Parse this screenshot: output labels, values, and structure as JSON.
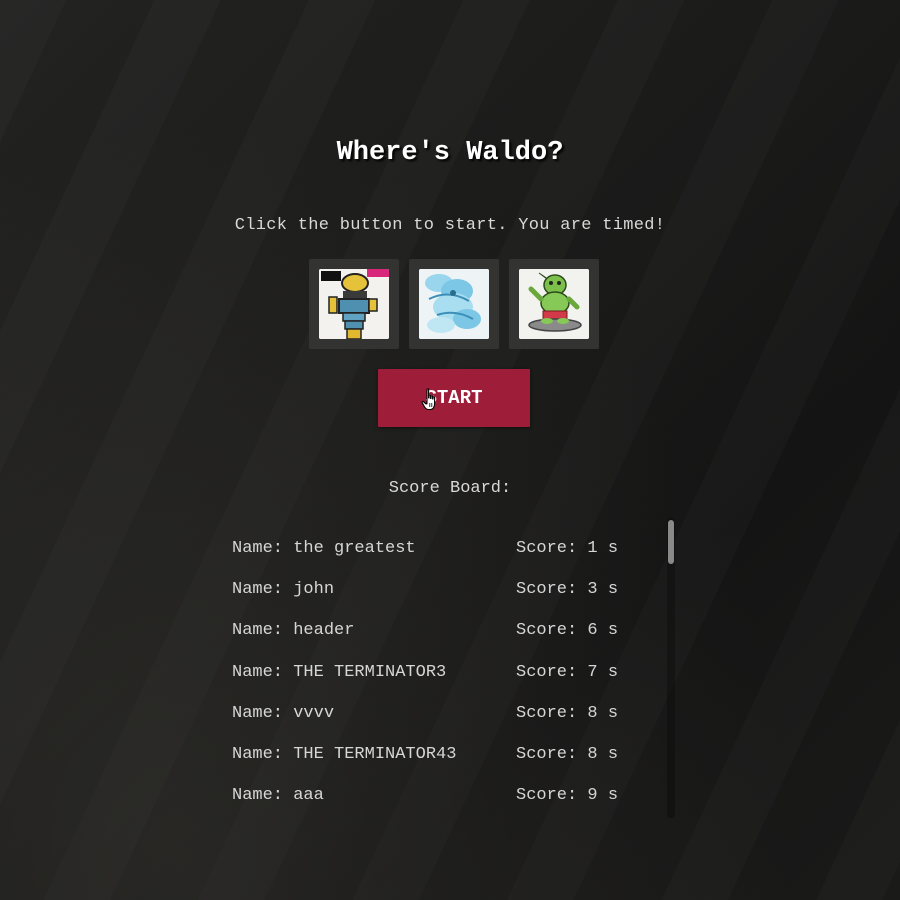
{
  "page": {
    "title": "Where's Waldo?",
    "instructions": "Click the button to start. You are timed!",
    "start_button_label": "START",
    "scoreboard_title": "Score Board:"
  },
  "characters": [
    {
      "icon": "robot-character-icon"
    },
    {
      "icon": "ghost-character-icon"
    },
    {
      "icon": "goblin-character-icon"
    }
  ],
  "scoreboard": {
    "rows": [
      {
        "name": "Name: the greatest",
        "score": "Score: 1 s"
      },
      {
        "name": "Name: john",
        "score": "Score: 3 s"
      },
      {
        "name": "Name: header",
        "score": "Score: 6 s"
      },
      {
        "name": "Name: THE TERMINATOR3",
        "score": "Score: 7 s"
      },
      {
        "name": "Name: vvvv",
        "score": "Score: 8 s"
      },
      {
        "name": "Name: THE TERMINATOR43",
        "score": "Score: 8 s"
      },
      {
        "name": "Name: aaa",
        "score": "Score: 9 s"
      }
    ]
  },
  "colors": {
    "accent": "#9e1d38",
    "background": "#1c1c1b",
    "text": "#d6d6d6"
  }
}
